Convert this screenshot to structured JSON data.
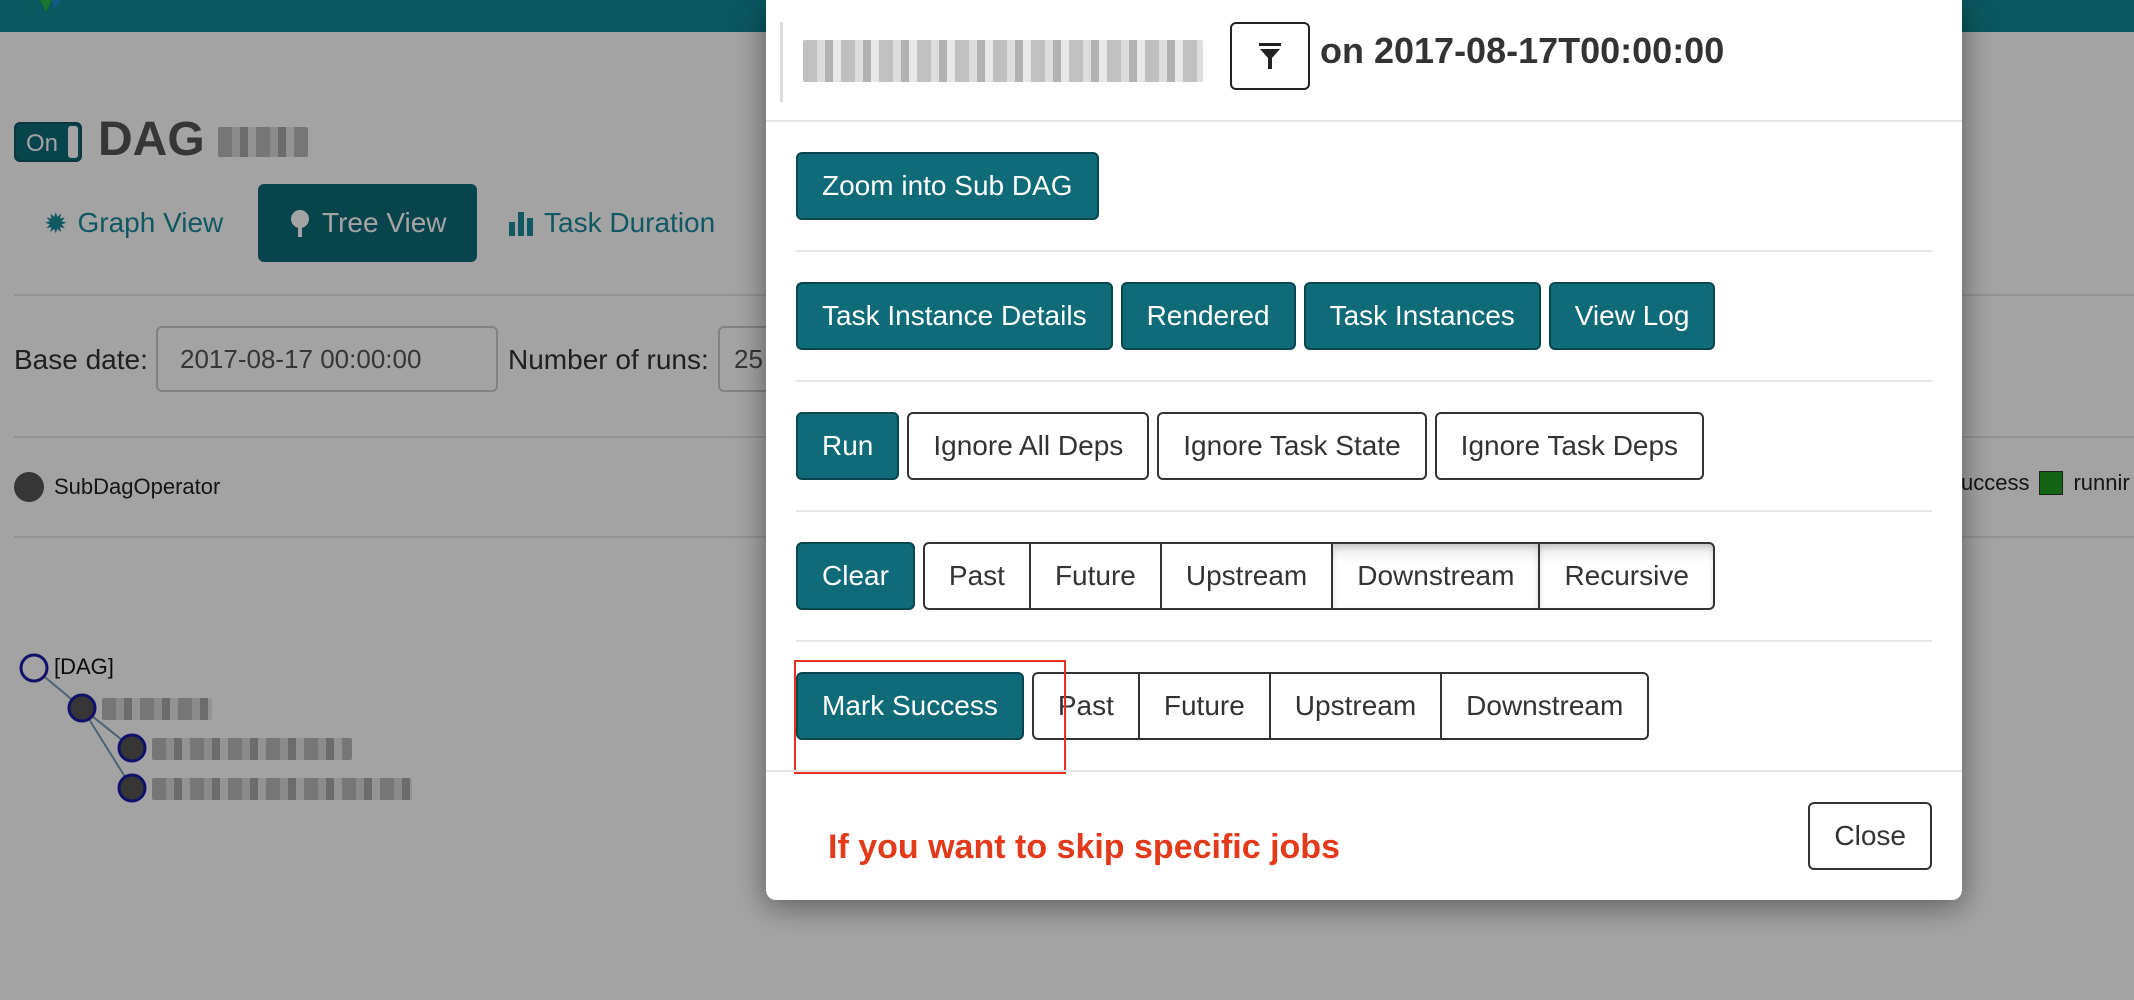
{
  "app": {
    "header_color": "#118a96"
  },
  "dag": {
    "toggle_label": "On",
    "title_prefix": "DAG"
  },
  "tabs": [
    {
      "label": "Graph View",
      "icon": "gear-icon"
    },
    {
      "label": "Tree View",
      "icon": "tree-icon"
    },
    {
      "label": "Task Duration",
      "icon": "bar-chart-icon"
    }
  ],
  "controls": {
    "base_date_label": "Base date:",
    "base_date_value": "2017-08-17 00:00:00",
    "runs_label": "Number of runs:",
    "runs_value": "25"
  },
  "legend": {
    "operator": "SubDagOperator",
    "success": "success",
    "running": "runnir"
  },
  "tree": {
    "root_label": "[DAG]"
  },
  "modal": {
    "date_prefix": "on 2017-08-17T00:00:00",
    "zoom": "Zoom into Sub DAG",
    "info_buttons": [
      "Task Instance Details",
      "Rendered",
      "Task Instances",
      "View Log"
    ],
    "run": {
      "label": "Run",
      "options": [
        "Ignore All Deps",
        "Ignore Task State",
        "Ignore Task Deps"
      ]
    },
    "clear": {
      "label": "Clear",
      "options": [
        "Past",
        "Future",
        "Upstream",
        "Downstream",
        "Recursive"
      ]
    },
    "mark_success": {
      "label": "Mark Success",
      "options": [
        "Past",
        "Future",
        "Upstream",
        "Downstream"
      ]
    },
    "annotation": "If you want to skip specific jobs",
    "close": "Close"
  },
  "colors": {
    "primary": "#0e6b77",
    "annotation": "#e23a1a"
  }
}
